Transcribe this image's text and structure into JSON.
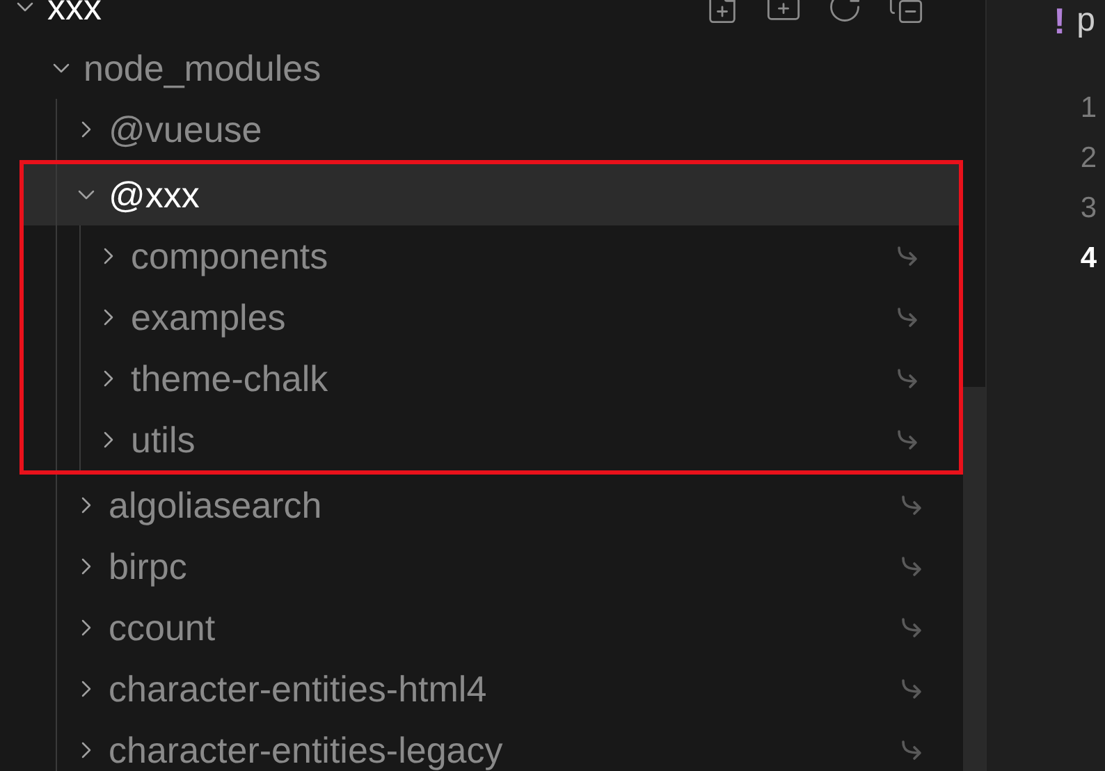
{
  "explorer": {
    "tree": [
      {
        "label": "xxx",
        "expanded": true,
        "selected": false,
        "dimmed": false,
        "symlink": false,
        "children": [
          {
            "label": "node_modules",
            "expanded": true,
            "selected": false,
            "dimmed": true,
            "symlink": false,
            "children": [
              {
                "label": "@vueuse",
                "expanded": false,
                "selected": false,
                "dimmed": true,
                "symlink": false
              },
              {
                "label": "@xxx",
                "expanded": true,
                "selected": true,
                "dimmed": false,
                "symlink": false,
                "annotated": true,
                "children": [
                  {
                    "label": "components",
                    "expanded": false,
                    "selected": false,
                    "dimmed": true,
                    "symlink": true
                  },
                  {
                    "label": "examples",
                    "expanded": false,
                    "selected": false,
                    "dimmed": true,
                    "symlink": true
                  },
                  {
                    "label": "theme-chalk",
                    "expanded": false,
                    "selected": false,
                    "dimmed": true,
                    "symlink": true
                  },
                  {
                    "label": "utils",
                    "expanded": false,
                    "selected": false,
                    "dimmed": true,
                    "symlink": true
                  }
                ]
              },
              {
                "label": "algoliasearch",
                "expanded": false,
                "selected": false,
                "dimmed": true,
                "symlink": true
              },
              {
                "label": "birpc",
                "expanded": false,
                "selected": false,
                "dimmed": true,
                "symlink": true
              },
              {
                "label": "ccount",
                "expanded": false,
                "selected": false,
                "dimmed": true,
                "symlink": true
              },
              {
                "label": "character-entities-html4",
                "expanded": false,
                "selected": false,
                "dimmed": true,
                "symlink": true
              },
              {
                "label": "character-entities-legacy",
                "expanded": false,
                "selected": false,
                "dimmed": true,
                "symlink": true
              }
            ]
          }
        ]
      }
    ]
  },
  "editor": {
    "tab_icon": "!",
    "tab_title": "p",
    "line_numbers": [
      {
        "text": "1",
        "current": false
      },
      {
        "text": "2",
        "current": false
      },
      {
        "text": "3",
        "current": false
      },
      {
        "text": "4",
        "current": true
      }
    ]
  }
}
